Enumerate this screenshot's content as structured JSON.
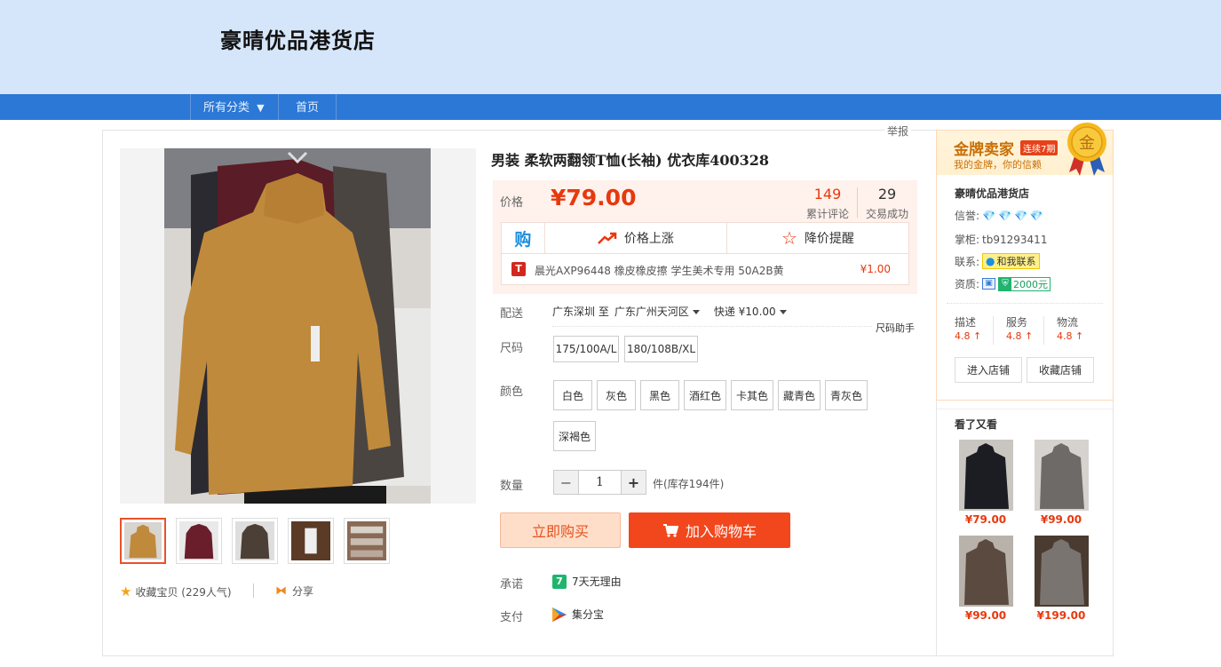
{
  "header": {
    "shop_title": "豪晴优品港货店"
  },
  "nav": {
    "all_categories": "所有分类",
    "home": "首页"
  },
  "report": "举报",
  "product": {
    "title": "男装 柔软两翻领T恤(长袖) 优衣库400328",
    "price_label": "价格",
    "price": "¥79.00",
    "reviews_count": "149",
    "reviews_label": "累计评论",
    "deals_count": "29",
    "deals_label": "交易成功",
    "buy_icon_text": "购",
    "price_up": "价格上涨",
    "price_alert": "降价提醒",
    "promo_icon": "T",
    "promo_text": "晨光AXP96448 橡皮橡皮擦 学生美术专用 50A2B黄",
    "promo_price": "¥1.00",
    "shipping_label": "配送",
    "ship_from": "广东深圳 至",
    "ship_to": "广东广州天河区",
    "ship_fee": "快递 ¥10.00",
    "size_helper": "尺码助手",
    "size_label": "尺码",
    "sizes": [
      "175/100A/L",
      "180/108B/XL"
    ],
    "color_label": "颜色",
    "colors": [
      "白色",
      "灰色",
      "黑色",
      "酒红色",
      "卡其色",
      "藏青色",
      "青灰色",
      "深褐色"
    ],
    "qty_label": "数量",
    "qty_minus": "−",
    "qty_value": "1",
    "qty_plus": "+",
    "stock": "件(库存194件)",
    "buy_now": "立即购买",
    "add_cart": "加入购物车",
    "promise_label": "承诺",
    "promise_icon": "7",
    "promise": "7天无理由",
    "pay_label": "支付",
    "pay": "集分宝",
    "favorite": "收藏宝贝 (229人气)",
    "share": "分享"
  },
  "seller": {
    "gold_title": "金牌卖家",
    "streak": "连续7期",
    "gold_sub": "我的金牌，你的信赖",
    "medal_text": "金",
    "name": "豪晴优品港货店",
    "credit_label": "信誉:",
    "owner_label": "掌柜:",
    "owner": "tb91293411",
    "contact_label": "联系:",
    "contact": "和我联系",
    "qual_label": "资质:",
    "deposit": "2000元",
    "scores": [
      {
        "label": "描述",
        "value": "4.8 ↑"
      },
      {
        "label": "服务",
        "value": "4.8 ↑"
      },
      {
        "label": "物流",
        "value": "4.8 ↑"
      }
    ],
    "enter_shop": "进入店铺",
    "fav_shop": "收藏店铺"
  },
  "seen": {
    "title": "看了又看",
    "items": [
      {
        "price": "¥79.00",
        "color": "#1c1d22"
      },
      {
        "price": "¥99.00",
        "color": "#6d6a68"
      },
      {
        "price": "¥99.00",
        "color": "#5a4a40"
      },
      {
        "price": "¥199.00",
        "color": "#7a7470"
      }
    ]
  },
  "colors": {
    "accent": "#f2471d",
    "price": "#e8380d",
    "nav": "#2b78d6",
    "header": "#d6e6fa"
  }
}
